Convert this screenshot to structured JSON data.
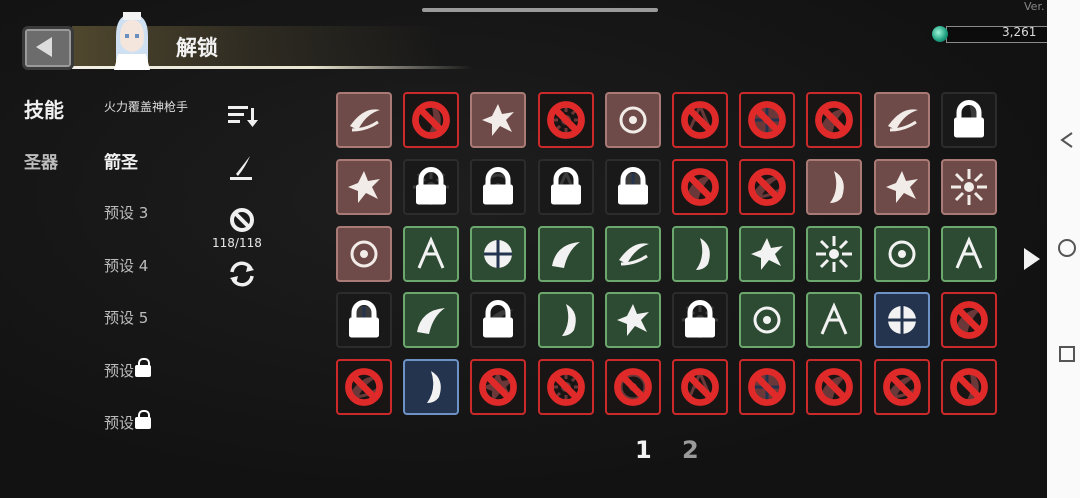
{
  "header": {
    "title": "解锁",
    "version": "Ver.",
    "currency_value": "3,261"
  },
  "categories": [
    {
      "label": "技能",
      "active": true
    },
    {
      "label": "圣器",
      "active": false
    }
  ],
  "presets": {
    "title": "火力覆盖神枪手",
    "items": [
      {
        "label": "箭圣",
        "active": true,
        "locked": false
      },
      {
        "label": "预设 3",
        "active": false,
        "locked": false
      },
      {
        "label": "预设 4",
        "active": false,
        "locked": false
      },
      {
        "label": "预设 5",
        "active": false,
        "locked": false
      },
      {
        "label": "预设",
        "active": false,
        "locked": true
      },
      {
        "label": "预设",
        "active": false,
        "locked": true
      }
    ]
  },
  "tools": {
    "sort_icon": "sort-icon",
    "edit_icon": "quill-icon",
    "ban_icon": "ban-icon",
    "count_text": "118/118",
    "refresh_icon": "refresh-icon"
  },
  "skills_grid": {
    "rows": [
      [
        {
          "state": "brown",
          "icon": "slash-icon",
          "banned": false,
          "locked": false
        },
        {
          "state": "red",
          "icon": "feather-icon",
          "banned": true,
          "locked": false
        },
        {
          "state": "brown",
          "icon": "burst-icon",
          "banned": false,
          "locked": false
        },
        {
          "state": "red",
          "icon": "spark-icon",
          "banned": true,
          "locked": false
        },
        {
          "state": "brown",
          "icon": "swap-arrows-icon",
          "banned": false,
          "locked": false
        },
        {
          "state": "red",
          "icon": "compass-icon",
          "banned": true,
          "locked": false
        },
        {
          "state": "red",
          "icon": "orb-icon",
          "banned": true,
          "locked": false
        },
        {
          "state": "red",
          "icon": "vortex-icon",
          "banned": true,
          "locked": false
        },
        {
          "state": "brown",
          "icon": "arrows-icon",
          "banned": false,
          "locked": false
        },
        {
          "state": "dark",
          "icon": "skull-icon",
          "banned": false,
          "locked": true
        }
      ],
      [
        {
          "state": "brown",
          "icon": "crescent-icon",
          "banned": false,
          "locked": false
        },
        {
          "state": "dark",
          "icon": "tiles-icon",
          "banned": false,
          "locked": true
        },
        {
          "state": "dark",
          "icon": "hand-icon",
          "banned": false,
          "locked": true
        },
        {
          "state": "dark",
          "icon": "target-icon",
          "banned": false,
          "locked": true
        },
        {
          "state": "dark",
          "icon": "blade-icon",
          "banned": false,
          "locked": true
        },
        {
          "state": "red",
          "icon": "spiral-icon",
          "banned": true,
          "locked": false
        },
        {
          "state": "red",
          "icon": "eye-icon",
          "banned": true,
          "locked": false
        },
        {
          "state": "brown",
          "icon": "streak-icon",
          "banned": false,
          "locked": false
        },
        {
          "state": "brown",
          "icon": "storm-icon",
          "banned": false,
          "locked": false
        },
        {
          "state": "brown",
          "icon": "fist-icon",
          "banned": false,
          "locked": false
        }
      ],
      [
        {
          "state": "brown",
          "icon": "ring-icon",
          "banned": false,
          "locked": false
        },
        {
          "state": "green",
          "icon": "comet-icon",
          "banned": false,
          "locked": false
        },
        {
          "state": "green",
          "icon": "chain-icon",
          "banned": false,
          "locked": false
        },
        {
          "state": "green",
          "icon": "leap-icon",
          "banned": false,
          "locked": false
        },
        {
          "state": "green",
          "icon": "jump-icon",
          "banned": false,
          "locked": false
        },
        {
          "state": "green",
          "icon": "flame-swirl-icon",
          "banned": false,
          "locked": false
        },
        {
          "state": "green",
          "icon": "explosion-icon",
          "banned": false,
          "locked": false
        },
        {
          "state": "green",
          "icon": "biohazard-icon",
          "banned": false,
          "locked": false
        },
        {
          "state": "green",
          "icon": "beam-icon",
          "banned": false,
          "locked": false
        },
        {
          "state": "green",
          "icon": "fire-icon",
          "banned": false,
          "locked": false
        }
      ],
      [
        {
          "state": "dark",
          "icon": "swirl-icon",
          "banned": false,
          "locked": true
        },
        {
          "state": "green",
          "icon": "needles-icon",
          "banned": false,
          "locked": false
        },
        {
          "state": "dark",
          "icon": "wings-icon",
          "banned": false,
          "locked": true
        },
        {
          "state": "green",
          "icon": "web-icon",
          "banned": false,
          "locked": false
        },
        {
          "state": "green",
          "icon": "scatter-icon",
          "banned": false,
          "locked": false
        },
        {
          "state": "dark",
          "icon": "shard-icon",
          "banned": false,
          "locked": true
        },
        {
          "state": "green",
          "icon": "shuriken-icon",
          "banned": false,
          "locked": false
        },
        {
          "state": "green",
          "icon": "shield-icon",
          "banned": false,
          "locked": false
        },
        {
          "state": "blue",
          "icon": "ball-icon",
          "banned": false,
          "locked": false
        },
        {
          "state": "red",
          "icon": "smoke-icon",
          "banned": true,
          "locked": false
        }
      ],
      [
        {
          "state": "red",
          "icon": "hourglass-icon",
          "banned": true,
          "locked": false
        },
        {
          "state": "blue",
          "icon": "kick-icon",
          "banned": false,
          "locked": false
        },
        {
          "state": "red",
          "icon": "dash-icon",
          "banned": true,
          "locked": false
        },
        {
          "state": "red",
          "icon": "thorn-icon",
          "banned": true,
          "locked": false
        },
        {
          "state": "red",
          "icon": "gear-icon",
          "banned": true,
          "locked": false
        },
        {
          "state": "red",
          "icon": "cross-blade-icon",
          "banned": true,
          "locked": false
        },
        {
          "state": "red",
          "icon": "rose-icon",
          "banned": true,
          "locked": false
        },
        {
          "state": "red",
          "icon": "wave-icon",
          "banned": true,
          "locked": false
        },
        {
          "state": "red",
          "icon": "cloud-icon",
          "banned": true,
          "locked": false
        },
        {
          "state": "red",
          "icon": "serpent-icon",
          "banned": true,
          "locked": false
        }
      ]
    ]
  },
  "pagination": {
    "page_1": "1",
    "page_2": "2",
    "next_icon": "next-page-icon"
  },
  "colors": {
    "brown": "#6e4a48",
    "red_border": "#cc2a2a",
    "green": "#2d4a33",
    "blue": "#24344e"
  }
}
